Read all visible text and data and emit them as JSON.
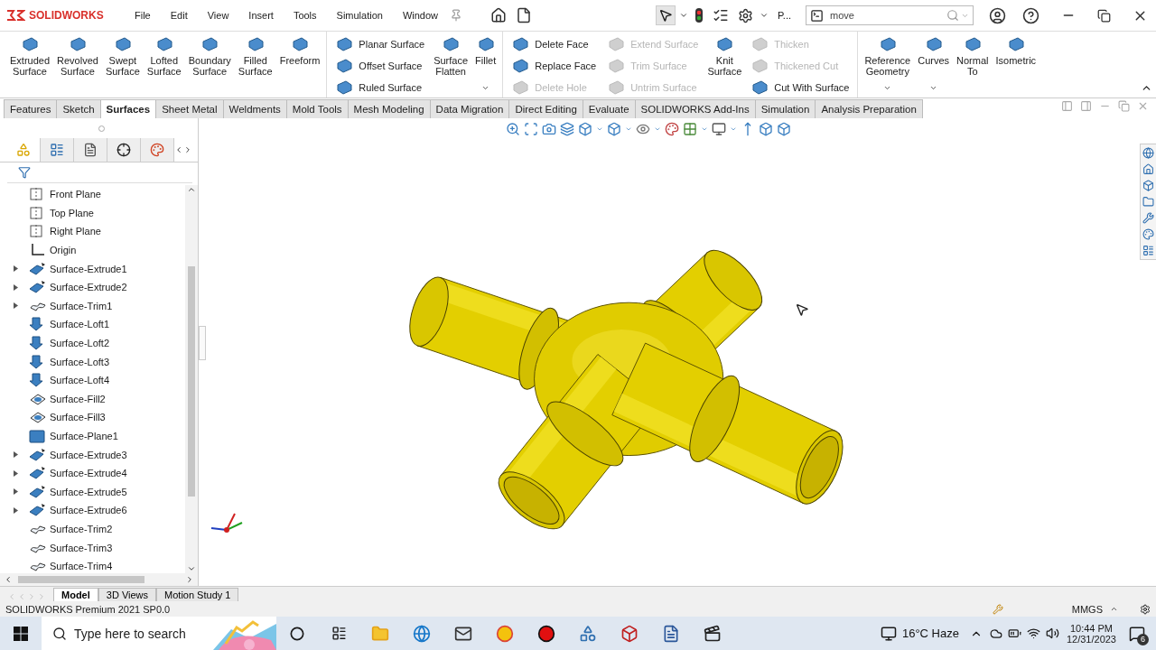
{
  "app": {
    "logo": "SOLIDWORKS"
  },
  "menu": [
    {
      "label": "File"
    },
    {
      "label": "Edit"
    },
    {
      "label": "View"
    },
    {
      "label": "Insert"
    },
    {
      "label": "Tools"
    },
    {
      "label": "Simulation"
    },
    {
      "label": "Window"
    }
  ],
  "toolbar": {
    "overflow": "P...",
    "command_search": {
      "value": "move"
    }
  },
  "ribbon": [
    {
      "items": [
        {
          "kind": "large",
          "label": "Extruded Surface",
          "dropdown": false
        },
        {
          "kind": "large",
          "label": "Revolved Surface",
          "dropdown": false
        },
        {
          "kind": "large",
          "label": "Swept Surface",
          "dropdown": false
        },
        {
          "kind": "large",
          "label": "Lofted Surface",
          "dropdown": false
        },
        {
          "kind": "large",
          "label": "Boundary Surface",
          "dropdown": false
        },
        {
          "kind": "large",
          "label": "Filled Surface",
          "dropdown": false
        },
        {
          "kind": "large",
          "label": "Freeform",
          "dropdown": false
        }
      ]
    },
    {
      "items": [
        {
          "kind": "stack",
          "entries": [
            {
              "label": "Planar Surface",
              "disabled": false
            },
            {
              "label": "Offset Surface",
              "disabled": false
            },
            {
              "label": "Ruled Surface",
              "disabled": false
            }
          ]
        },
        {
          "kind": "large",
          "label": "Surface Flatten",
          "dropdown": false
        },
        {
          "kind": "large",
          "label": "Fillet",
          "dropdown": true
        }
      ]
    },
    {
      "items": [
        {
          "kind": "stack",
          "entries": [
            {
              "label": "Delete Face",
              "disabled": false
            },
            {
              "label": "Replace Face",
              "disabled": false
            },
            {
              "label": "Delete Hole",
              "disabled": true
            }
          ]
        },
        {
          "kind": "stack",
          "entries": [
            {
              "label": "Extend Surface",
              "disabled": true
            },
            {
              "label": "Trim Surface",
              "disabled": true
            },
            {
              "label": "Untrim Surface",
              "disabled": true
            }
          ]
        },
        {
          "kind": "large",
          "label": "Knit Surface",
          "dropdown": false
        },
        {
          "kind": "stack",
          "entries": [
            {
              "label": "Thicken",
              "disabled": true
            },
            {
              "label": "Thickened Cut",
              "disabled": true
            },
            {
              "label": "Cut With Surface",
              "disabled": false
            }
          ]
        }
      ]
    },
    {
      "items": [
        {
          "kind": "large",
          "label": "Reference Geometry",
          "dropdown": true
        },
        {
          "kind": "large",
          "label": "Curves",
          "dropdown": true
        },
        {
          "kind": "large",
          "label": "Normal To",
          "dropdown": false
        },
        {
          "kind": "large",
          "label": "Isometric",
          "dropdown": false
        }
      ]
    }
  ],
  "command_tabs": [
    {
      "label": "Features",
      "selected": false
    },
    {
      "label": "Sketch",
      "selected": false
    },
    {
      "label": "Surfaces",
      "selected": true
    },
    {
      "label": "Sheet Metal",
      "selected": false
    },
    {
      "label": "Weldments",
      "selected": false
    },
    {
      "label": "Mold Tools",
      "selected": false
    },
    {
      "label": "Mesh Modeling",
      "selected": false
    },
    {
      "label": "Data Migration",
      "selected": false
    },
    {
      "label": "Direct Editing",
      "selected": false
    },
    {
      "label": "Evaluate",
      "selected": false
    },
    {
      "label": "SOLIDWORKS Add-Ins",
      "selected": false
    },
    {
      "label": "Simulation",
      "selected": false
    },
    {
      "label": "Analysis Preparation",
      "selected": false
    }
  ],
  "feature_tree": {
    "items": [
      {
        "label": "Front Plane",
        "kind": "plane",
        "collapsible": false
      },
      {
        "label": "Top Plane",
        "kind": "plane",
        "collapsible": false
      },
      {
        "label": "Right Plane",
        "kind": "plane",
        "collapsible": false
      },
      {
        "label": "Origin",
        "kind": "origin",
        "collapsible": false
      },
      {
        "label": "Surface-Extrude1",
        "kind": "extrude",
        "collapsible": true
      },
      {
        "label": "Surface-Extrude2",
        "kind": "extrude",
        "collapsible": true
      },
      {
        "label": "Surface-Trim1",
        "kind": "trim",
        "collapsible": true
      },
      {
        "label": "Surface-Loft1",
        "kind": "loft",
        "collapsible": false
      },
      {
        "label": "Surface-Loft2",
        "kind": "loft",
        "collapsible": false
      },
      {
        "label": "Surface-Loft3",
        "kind": "loft",
        "collapsible": false
      },
      {
        "label": "Surface-Loft4",
        "kind": "loft",
        "collapsible": false
      },
      {
        "label": "Surface-Fill2",
        "kind": "fill",
        "collapsible": false
      },
      {
        "label": "Surface-Fill3",
        "kind": "fill",
        "collapsible": false
      },
      {
        "label": "Surface-Plane1",
        "kind": "planar",
        "collapsible": false
      },
      {
        "label": "Surface-Extrude3",
        "kind": "extrude",
        "collapsible": true
      },
      {
        "label": "Surface-Extrude4",
        "kind": "extrude",
        "collapsible": true
      },
      {
        "label": "Surface-Extrude5",
        "kind": "extrude",
        "collapsible": true
      },
      {
        "label": "Surface-Extrude6",
        "kind": "extrude",
        "collapsible": true
      },
      {
        "label": "Surface-Trim2",
        "kind": "trim",
        "collapsible": false
      },
      {
        "label": "Surface-Trim3",
        "kind": "trim",
        "collapsible": false
      },
      {
        "label": "Surface-Trim4",
        "kind": "trim",
        "collapsible": false
      }
    ]
  },
  "bottom_tabs": [
    {
      "label": "Model",
      "selected": true
    },
    {
      "label": "3D Views",
      "selected": false
    },
    {
      "label": "Motion Study 1",
      "selected": false
    }
  ],
  "status_bar": {
    "product": "SOLIDWORKS Premium 2021 SP0.0",
    "units": "MMGS"
  },
  "taskbar": {
    "search": {
      "placeholder": "Type here to search"
    },
    "weather": "16°C Haze",
    "time": "10:44 PM",
    "date": "12/31/2023",
    "notifications": "6"
  }
}
